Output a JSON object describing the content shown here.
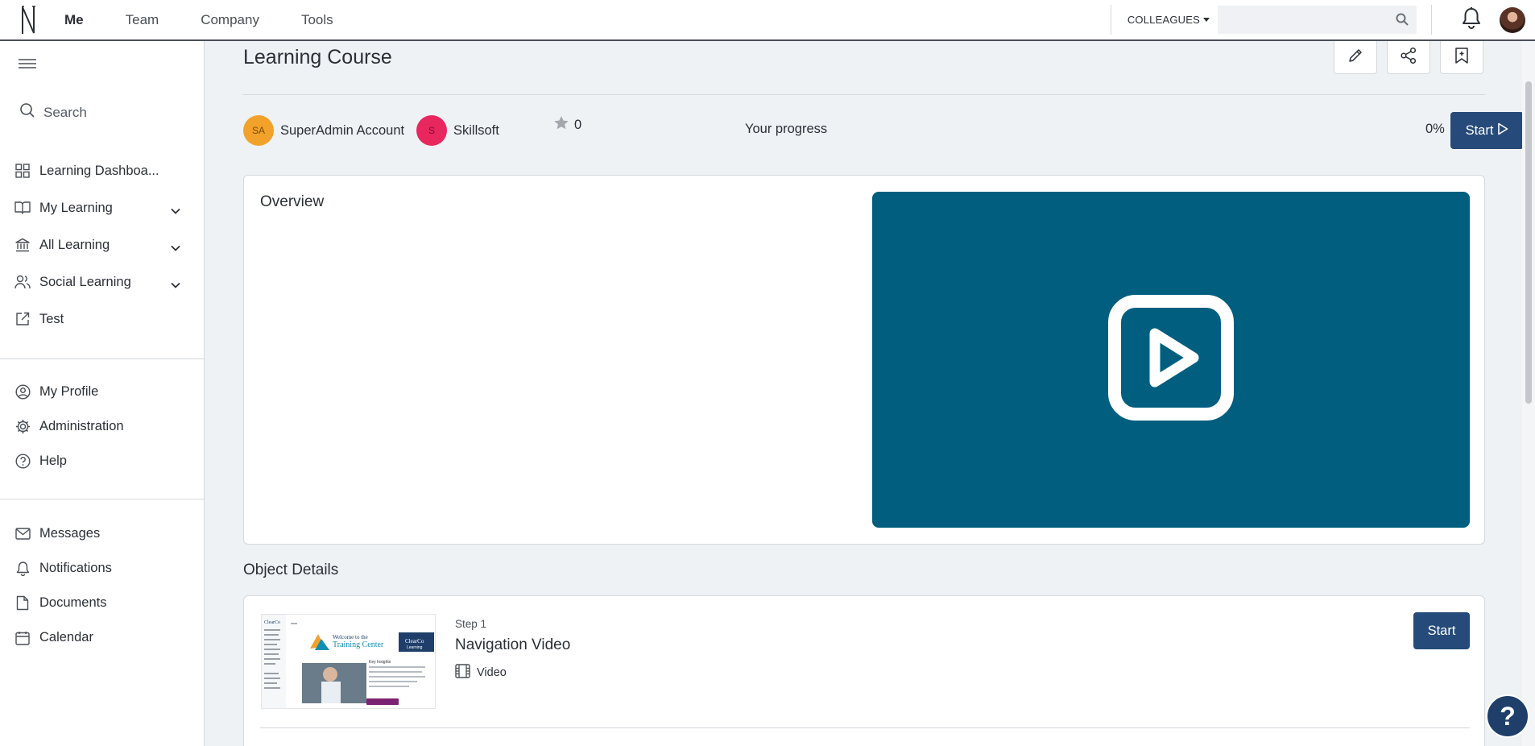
{
  "topbar": {
    "nav": [
      {
        "label": "Me",
        "active": true
      },
      {
        "label": "Team",
        "active": false
      },
      {
        "label": "Company",
        "active": false
      },
      {
        "label": "Tools",
        "active": false
      }
    ],
    "colleagues_label": "COLLEAGUES",
    "search_placeholder": "",
    "icons": [
      "logo-icon",
      "search-icon",
      "bell-icon",
      "user-avatar"
    ]
  },
  "sidebar": {
    "search_label": "Search",
    "primary": [
      {
        "label": "Learning Dashboa...",
        "icon": "dashboard-grid-icon"
      },
      {
        "label": "My Learning",
        "icon": "book-icon",
        "expandable": true
      },
      {
        "label": "All Learning",
        "icon": "institution-icon",
        "expandable": true
      },
      {
        "label": "Social Learning",
        "icon": "users-icon",
        "expandable": true
      },
      {
        "label": "Test",
        "icon": "external-link-icon"
      }
    ],
    "secondary": [
      {
        "label": "My Profile",
        "icon": "user-circle-icon"
      },
      {
        "label": "Administration",
        "icon": "gear-icon"
      },
      {
        "label": "Help",
        "icon": "question-circle-icon"
      }
    ],
    "tertiary": [
      {
        "label": "Messages",
        "icon": "mail-icon"
      },
      {
        "label": "Notifications",
        "icon": "bell-icon"
      },
      {
        "label": "Documents",
        "icon": "document-icon"
      },
      {
        "label": "Calendar",
        "icon": "calendar-icon"
      }
    ]
  },
  "page": {
    "title": "Learning Course",
    "actions": [
      "edit-pencil-icon",
      "share-icon",
      "bookmark-icon"
    ],
    "author": {
      "initials": "SA",
      "name": "SuperAdmin Account",
      "color": "#f2a22a"
    },
    "provider": {
      "initials": "S",
      "name": "Skillsoft",
      "color": "#e8275f"
    },
    "rating": "0",
    "progress_label": "Your progress",
    "progress_value": "0%",
    "progress_fraction": 0,
    "start_label": "Start",
    "overview_title": "Overview",
    "video_color": "#025e7f",
    "details_title": "Object Details",
    "steps": [
      {
        "step": "Step 1",
        "title": "Navigation Video",
        "type": "Video",
        "start_label": "Start"
      }
    ]
  },
  "help_label": "?",
  "colors": {
    "primary": "#264a79",
    "page_bg": "#eff2f5"
  }
}
